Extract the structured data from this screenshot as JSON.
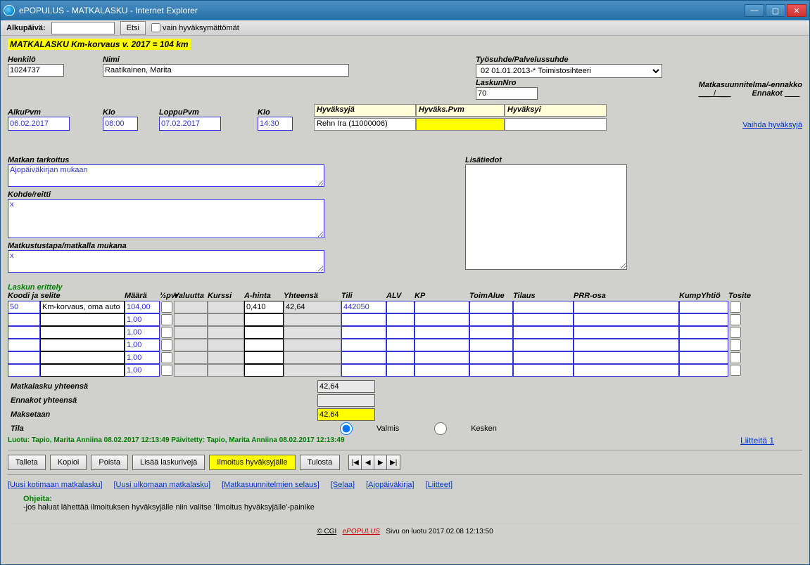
{
  "window": {
    "title": "ePOPULUS - MATKALASKU - Internet Explorer"
  },
  "menubar": {
    "alkupaiva_label": "Alkupäivä:",
    "etsi": "Etsi",
    "vain": "vain hyväksymättömät"
  },
  "heading": "MATKALASKU    Km-korvaus v. 2017 = 104 km",
  "labels": {
    "henkilo": "Henkilö",
    "nimi": "Nimi",
    "tyosuhde": "Työsuhde/Palvelussuhde",
    "laskunro": "LaskunNro",
    "matkasuun": "Matkasuunnitelma/-ennakko",
    "ennakot": "Ennakot",
    "alkupvm": "AlkuPvm",
    "klo1": "Klo",
    "loppupvm": "LoppuPvm",
    "klo2": "Klo",
    "hyvaksyja": "Hyväksyjä",
    "hyvakspvm": "Hyväks.Pvm",
    "hyvaksyi": "Hyväksyi",
    "vaihda": "Vaihda hyväksyjä",
    "tarkoitus": "Matkan tarkoitus",
    "lisatiedot": "Lisätiedot",
    "kohde": "Kohde/reitti",
    "tapa": "Matkustustapa/matkalla mukana",
    "erittely": "Laskun erittely",
    "yhteensa": "Matkalasku yhteensä",
    "ennakot_yht": "Ennakot yhteensä",
    "maksetaan": "Maksetaan",
    "tila": "Tila",
    "valmis": "Valmis",
    "kesken": "Kesken",
    "liitteita": "Liitteitä 1"
  },
  "values": {
    "henkilo": "1024737",
    "nimi": "Raatikainen, Marita",
    "tyosuhde": "02 01.01.2013-* Toimistosihteeri",
    "laskunro": "70",
    "matkasuun": "___ / ___",
    "alkupvm": "06.02.2017",
    "klo1": "08:00",
    "loppupvm": "07.02.2017",
    "klo2": "14:30",
    "hyvaksyja": "Rehn Ira (11000006)",
    "tarkoitus": "Ajopäiväkirjan mukaan",
    "kohde": "x",
    "tapa": "x",
    "yhteensa": "42,64",
    "ennakot_yht": "",
    "maksetaan": "42,64"
  },
  "grid": {
    "headers": {
      "koodi": "Koodi ja selite",
      "maara": "Määrä",
      "half": "½pvr",
      "valuutta": "Valuutta",
      "kurssi": "Kurssi",
      "ahinta": "A-hinta",
      "yhteensa": "Yhteensä",
      "tili": "Tili",
      "alv": "ALV",
      "kp": "KP",
      "toim": "ToimAlue",
      "tilaus": "Tilaus",
      "prr": "PRR-osa",
      "kump": "KumpYhtiö",
      "tosite": "Tosite"
    },
    "rows": [
      {
        "koodi": "50",
        "selite": "Km-korvaus, oma auto",
        "maara": "104,00",
        "ahinta": "0,410",
        "yht": "42,64",
        "tili": "442050"
      },
      {
        "maara": "1,00"
      },
      {
        "maara": "1,00"
      },
      {
        "maara": "1,00"
      },
      {
        "maara": "1,00"
      },
      {
        "maara": "1,00"
      }
    ]
  },
  "audit": "Luotu: Tapio, Marita Anniina 08.02.2017 12:13:49    Päivitetty: Tapio, Marita Anniina 08.02.2017 12:13:49",
  "buttons": {
    "talleta": "Talleta",
    "kopioi": "Kopioi",
    "poista": "Poista",
    "lisaa": "Lisää laskurivejä",
    "ilmoitus": "Ilmoitus hyväksyjälle",
    "tulosta": "Tulosta"
  },
  "links": {
    "l1": "[Uusi kotimaan matkalasku]",
    "l2": "[Uusi ulkomaan matkalasku]",
    "l3": "[Matkasuunnitelmien selaus]",
    "l4": "[Selaa]",
    "l5": "[Ajopäiväkirja]",
    "l6": "[Liitteet]"
  },
  "guide": {
    "title": "Ohjeita:",
    "item": "-jos haluat lähettää ilmoituksen hyväksyjälle niin valitse 'Ilmoitus hyväksyjälle'-painike"
  },
  "footer": {
    "cgi": "© CGI",
    "epop": "ePOPULUS",
    "rest": "Sivu on luotu  2017.02.08 12:13:50"
  }
}
